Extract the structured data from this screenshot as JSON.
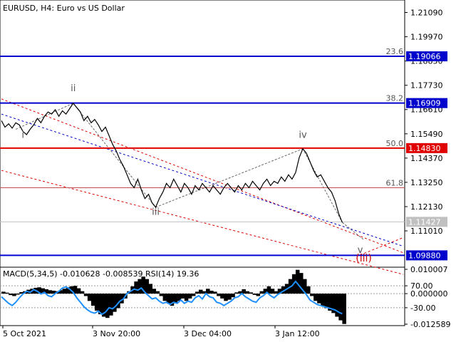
{
  "header": {
    "symbol": "EURUSD",
    "timeframe": "H4:",
    "description": "Euro vs US Dollar"
  },
  "colors": {
    "background": "#ffffff",
    "price_line": "#000000",
    "blue_level": "#0000cc",
    "red_level": "#e00000",
    "fib_line": "#c05050",
    "wave_label": "#555555",
    "wave_label_red": "#cc0000",
    "macd_hist": "#000000",
    "rsi_line": "#1e90ff",
    "current_price_tag": "#c0c0c0",
    "axis_text": "#000000"
  },
  "chart_data": [
    {
      "type": "line",
      "title": "EURUSD, H4: Euro vs US Dollar",
      "x_labels": [
        "5 Oct 2021",
        "3 Nov 20:00",
        "3 Dec 04:00",
        "3 Jan 12:00"
      ],
      "y_ticks": [
        "1.21090",
        "1.19970",
        "1.18850",
        "1.17730",
        "1.16610",
        "1.15490",
        "1.14370",
        "1.13250",
        "1.12130",
        "1.11010"
      ],
      "ylim": [
        1.094,
        1.216
      ],
      "price_series": [
        [
          0,
          1.161
        ],
        [
          1,
          1.158
        ],
        [
          2,
          1.1595
        ],
        [
          3,
          1.1575
        ],
        [
          4,
          1.16
        ],
        [
          5,
          1.159
        ],
        [
          6,
          1.156
        ],
        [
          7,
          1.1545
        ],
        [
          8,
          1.157
        ],
        [
          9,
          1.159
        ],
        [
          10,
          1.162
        ],
        [
          11,
          1.16
        ],
        [
          12,
          1.163
        ],
        [
          13,
          1.165
        ],
        [
          14,
          1.164
        ],
        [
          15,
          1.166
        ],
        [
          16,
          1.163
        ],
        [
          17,
          1.1655
        ],
        [
          18,
          1.164
        ],
        [
          19,
          1.1665
        ],
        [
          20,
          1.169
        ],
        [
          21,
          1.167
        ],
        [
          22,
          1.165
        ],
        [
          23,
          1.161
        ],
        [
          24,
          1.163
        ],
        [
          25,
          1.16
        ],
        [
          26,
          1.1615
        ],
        [
          27,
          1.159
        ],
        [
          28,
          1.156
        ],
        [
          29,
          1.158
        ],
        [
          30,
          1.154
        ],
        [
          31,
          1.15
        ],
        [
          32,
          1.147
        ],
        [
          33,
          1.143
        ],
        [
          34,
          1.14
        ],
        [
          35,
          1.136
        ],
        [
          36,
          1.132
        ],
        [
          37,
          1.13
        ],
        [
          38,
          1.134
        ],
        [
          39,
          1.129
        ],
        [
          40,
          1.125
        ],
        [
          41,
          1.127
        ],
        [
          42,
          1.123
        ],
        [
          43,
          1.121
        ],
        [
          44,
          1.125
        ],
        [
          45,
          1.128
        ],
        [
          46,
          1.132
        ],
        [
          47,
          1.13
        ],
        [
          48,
          1.134
        ],
        [
          49,
          1.131
        ],
        [
          50,
          1.128
        ],
        [
          51,
          1.132
        ],
        [
          52,
          1.13
        ],
        [
          53,
          1.127
        ],
        [
          54,
          1.131
        ],
        [
          55,
          1.129
        ],
        [
          56,
          1.132
        ],
        [
          57,
          1.13
        ],
        [
          58,
          1.128
        ],
        [
          59,
          1.131
        ],
        [
          60,
          1.129
        ],
        [
          61,
          1.127
        ],
        [
          62,
          1.13
        ],
        [
          63,
          1.132
        ],
        [
          64,
          1.13
        ],
        [
          65,
          1.128
        ],
        [
          66,
          1.131
        ],
        [
          67,
          1.129
        ],
        [
          68,
          1.132
        ],
        [
          69,
          1.13
        ],
        [
          70,
          1.133
        ],
        [
          71,
          1.131
        ],
        [
          72,
          1.129
        ],
        [
          73,
          1.132
        ],
        [
          74,
          1.134
        ],
        [
          75,
          1.131
        ],
        [
          76,
          1.133
        ],
        [
          77,
          1.132
        ],
        [
          78,
          1.135
        ],
        [
          79,
          1.133
        ],
        [
          80,
          1.136
        ],
        [
          81,
          1.134
        ],
        [
          82,
          1.137
        ],
        [
          83,
          1.144
        ],
        [
          84,
          1.148
        ],
        [
          85,
          1.146
        ],
        [
          86,
          1.142
        ],
        [
          87,
          1.138
        ],
        [
          88,
          1.135
        ],
        [
          89,
          1.136
        ],
        [
          90,
          1.133
        ],
        [
          91,
          1.13
        ],
        [
          92,
          1.128
        ],
        [
          93,
          1.124
        ],
        [
          94,
          1.118
        ],
        [
          95,
          1.114
        ]
      ],
      "fib_levels": [
        {
          "label": "23.6",
          "value": 1.19066
        },
        {
          "label": "38.2",
          "value": 1.16909
        },
        {
          "label": "50.0",
          "value": 1.1483
        },
        {
          "label": "61.8",
          "value": 1.13
        }
      ],
      "price_tags": [
        {
          "text": "1.19066",
          "value": 1.19066,
          "style": "blue"
        },
        {
          "text": "1.16909",
          "value": 1.16909,
          "style": "blue"
        },
        {
          "text": "1.14830",
          "value": 1.1483,
          "style": "red"
        },
        {
          "text": "1.11427",
          "value": 1.11427,
          "style": "current"
        },
        {
          "text": "1.09880",
          "value": 1.0988,
          "style": "blue"
        }
      ],
      "horizontal_levels": [
        {
          "value": 1.19066,
          "style": "blue"
        },
        {
          "value": 1.16909,
          "style": "blue"
        },
        {
          "value": 1.1483,
          "style": "red"
        },
        {
          "value": 1.0988,
          "style": "blue"
        }
      ],
      "wave_labels": [
        {
          "text": "i",
          "x": 6,
          "value": 1.153,
          "style": "gray"
        },
        {
          "text": "ii",
          "x": 20,
          "value": 1.1745,
          "style": "gray"
        },
        {
          "text": "iii",
          "x": 43,
          "value": 1.1175,
          "style": "gray"
        },
        {
          "text": "iv",
          "x": 84,
          "value": 1.153,
          "style": "gray"
        },
        {
          "text": "v",
          "x": 100,
          "value": 1.1,
          "style": "gray"
        },
        {
          "text": "(iii)",
          "x": 101,
          "value": 1.096,
          "style": "red"
        }
      ],
      "grid": false
    },
    {
      "type": "line",
      "title": "MACD(5,34,5) -0.010628 -0.008539 RSI(14) 19.36",
      "y_ticks": [
        "0.010007",
        "70.00",
        "0.000000",
        "-30.00",
        "-0.012589"
      ],
      "ylim": [
        -0.012589,
        0.010007
      ],
      "macd_histogram": [
        0.0008,
        0.0004,
        -0.0006,
        -0.001,
        -0.0004,
        0.0006,
        0.001,
        0.0016,
        0.002,
        0.0024,
        0.0026,
        0.0022,
        0.0018,
        0.0014,
        0.0012,
        0.001,
        0.0014,
        0.002,
        0.0026,
        0.003,
        0.0032,
        0.0022,
        0.001,
        -0.001,
        -0.003,
        -0.005,
        -0.007,
        -0.0085,
        -0.0095,
        -0.01,
        -0.009,
        -0.0075,
        -0.006,
        -0.004,
        -0.002,
        0.001,
        0.003,
        0.005,
        0.006,
        0.007,
        0.006,
        0.004,
        0.002,
        0.001,
        -0.001,
        -0.003,
        -0.004,
        -0.005,
        -0.004,
        -0.003,
        -0.002,
        -0.003,
        -0.002,
        -0.001,
        0.0008,
        0.0016,
        0.001,
        0.002,
        0.0012,
        0.0008,
        -0.001,
        -0.002,
        -0.003,
        -0.0025,
        -0.0015,
        0.0005,
        0.001,
        0.0018,
        0.001,
        0.0005,
        -0.0005,
        -0.001,
        0.001,
        0.002,
        0.003,
        0.002,
        0.001,
        0.002,
        0.003,
        0.004,
        0.006,
        0.008,
        0.0098,
        0.0085,
        0.006,
        0.003,
        -0.001,
        -0.003,
        -0.004,
        -0.005,
        -0.006,
        -0.007,
        -0.008,
        -0.0095,
        -0.011,
        -0.0125
      ],
      "rsi_series": [
        50,
        44,
        38,
        34,
        40,
        48,
        55,
        60,
        58,
        63,
        60,
        55,
        58,
        52,
        50,
        56,
        60,
        66,
        68,
        64,
        58,
        48,
        40,
        32,
        26,
        22,
        20,
        24,
        18,
        22,
        30,
        28,
        34,
        42,
        46,
        56,
        60,
        64,
        62,
        66,
        58,
        52,
        46,
        48,
        42,
        38,
        40,
        36,
        40,
        38,
        44,
        38,
        42,
        40,
        48,
        52,
        46,
        56,
        50,
        48,
        40,
        38,
        34,
        38,
        42,
        48,
        50,
        56,
        50,
        46,
        42,
        40,
        48,
        52,
        58,
        52,
        48,
        54,
        58,
        62,
        66,
        70,
        78,
        70,
        62,
        54,
        44,
        40,
        36,
        34,
        32,
        30,
        28,
        26,
        22,
        19
      ]
    }
  ]
}
